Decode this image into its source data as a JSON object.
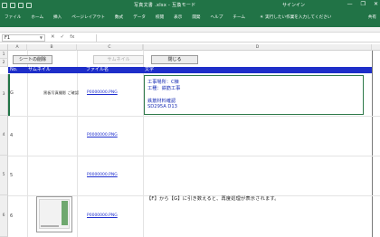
{
  "titlebar": {
    "title": "写真文書 .xlsx - 互換モード",
    "signin": "サインイン",
    "minimize": "—",
    "restore": "❐",
    "close": "✕"
  },
  "ribbon": {
    "tabs": [
      "ファイル",
      "ホーム",
      "挿入",
      "ページレイアウト",
      "数式",
      "データ",
      "校閲",
      "表示",
      "開発",
      "ヘルプ",
      "チーム"
    ],
    "tell_me": "実行したい作業を入力してください",
    "share": "共有"
  },
  "formula_bar": {
    "name_box": "F1",
    "cancel": "✕",
    "enter": "✓",
    "fx": "fx",
    "value": ""
  },
  "columns": [
    "A",
    "B",
    "C",
    "",
    "D"
  ],
  "rows": [
    "1",
    "2",
    "3",
    "4",
    "5",
    "6"
  ],
  "buttons": {
    "sheet_delete": "シートの削除",
    "thumbnail": "サムネイル",
    "close": "閉じる"
  },
  "table_header": {
    "no": "No.",
    "thumbnail": "サムネイル",
    "filename": "ファイル名",
    "comment": "文字"
  },
  "rows_data": [
    {
      "marker": "G",
      "thumb_caption": "黒板写真撮影 ご確認",
      "filename": "P0000000.PNG",
      "comment_lines": [
        "工事場所：C棟",
        "工種：鉄筋工事",
        "",
        "鉄筋材料確認",
        "SD295A D13"
      ]
    },
    {
      "marker": "4",
      "filename": "P0000000.PNG"
    },
    {
      "marker": "5",
      "filename": "P0000000.PNG"
    },
    {
      "marker": "6",
      "filename": "P0000000.PNG",
      "note": "【F】から【G】に引き数えると、再度処理が表示されます。"
    }
  ],
  "colors": {
    "title_green": "#217346",
    "header_blue": "#1e2ec9",
    "link_blue": "#1f2fcf"
  }
}
